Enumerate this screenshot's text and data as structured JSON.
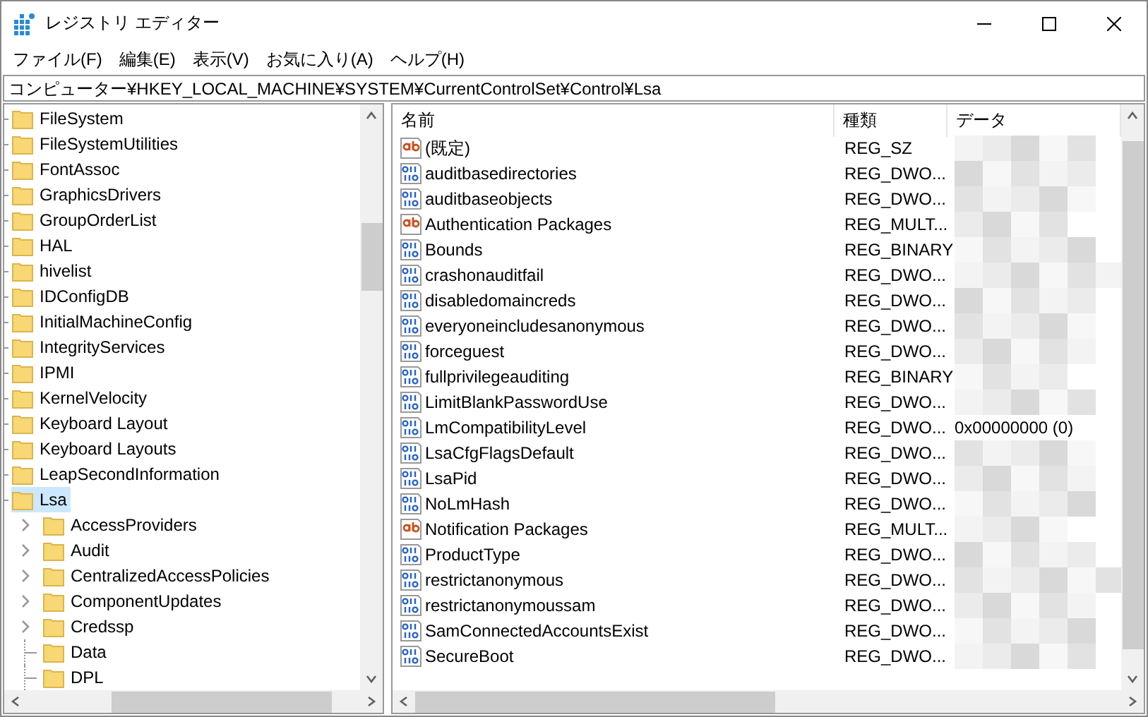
{
  "window": {
    "title": "レジストリ エディター"
  },
  "menu": [
    "ファイル(F)",
    "編集(E)",
    "表示(V)",
    "お気に入り(A)",
    "ヘルプ(H)"
  ],
  "address": "コンピューター¥HKEY_LOCAL_MACHINE¥SYSTEM¥CurrentControlSet¥Control¥Lsa",
  "tree": [
    {
      "label": "FileSystem",
      "selected": false
    },
    {
      "label": "FileSystemUtilities",
      "selected": false
    },
    {
      "label": "FontAssoc",
      "selected": false
    },
    {
      "label": "GraphicsDrivers",
      "selected": false
    },
    {
      "label": "GroupOrderList",
      "selected": false
    },
    {
      "label": "HAL",
      "selected": false
    },
    {
      "label": "hivelist",
      "selected": false
    },
    {
      "label": "IDConfigDB",
      "selected": false
    },
    {
      "label": "InitialMachineConfig",
      "selected": false
    },
    {
      "label": "IntegrityServices",
      "selected": false
    },
    {
      "label": "IPMI",
      "selected": false
    },
    {
      "label": "KernelVelocity",
      "selected": false
    },
    {
      "label": "Keyboard Layout",
      "selected": false
    },
    {
      "label": "Keyboard Layouts",
      "selected": false
    },
    {
      "label": "LeapSecondInformation",
      "selected": false
    },
    {
      "label": "Lsa",
      "selected": true,
      "children": [
        {
          "label": "AccessProviders",
          "selected": false,
          "has_children": true
        },
        {
          "label": "Audit",
          "selected": false,
          "has_children": true
        },
        {
          "label": "CentralizedAccessPolicies",
          "selected": false,
          "has_children": true
        },
        {
          "label": "ComponentUpdates",
          "selected": false,
          "has_children": true
        },
        {
          "label": "Credssp",
          "selected": false,
          "has_children": true
        },
        {
          "label": "Data",
          "selected": false,
          "has_children": false
        },
        {
          "label": "DPL",
          "selected": false,
          "has_children": false
        }
      ]
    }
  ],
  "table": {
    "columns": [
      "名前",
      "種類",
      "データ"
    ],
    "rows": [
      {
        "kind": "string",
        "name": "(既定)",
        "type": "REG_SZ",
        "redacted": true
      },
      {
        "kind": "binary",
        "name": "auditbasedirectories",
        "type": "REG_DWO...",
        "redacted": true
      },
      {
        "kind": "binary",
        "name": "auditbaseobjects",
        "type": "REG_DWO...",
        "redacted": true
      },
      {
        "kind": "string",
        "name": "Authentication Packages",
        "type": "REG_MULT...",
        "redacted": true
      },
      {
        "kind": "binary",
        "name": "Bounds",
        "type": "REG_BINARY",
        "redacted": true
      },
      {
        "kind": "binary",
        "name": "crashonauditfail",
        "type": "REG_DWO...",
        "redacted": true
      },
      {
        "kind": "binary",
        "name": "disabledomaincreds",
        "type": "REG_DWO...",
        "redacted": true
      },
      {
        "kind": "binary",
        "name": "everyoneincludesanonymous",
        "type": "REG_DWO...",
        "redacted": true
      },
      {
        "kind": "binary",
        "name": "forceguest",
        "type": "REG_DWO...",
        "redacted": true
      },
      {
        "kind": "binary",
        "name": "fullprivilegeauditing",
        "type": "REG_BINARY",
        "redacted": true
      },
      {
        "kind": "binary",
        "name": "LimitBlankPasswordUse",
        "type": "REG_DWO...",
        "redacted": true
      },
      {
        "kind": "binary",
        "name": "LmCompatibilityLevel",
        "type": "REG_DWO...",
        "redacted": false,
        "data": "0x00000000 (0)"
      },
      {
        "kind": "binary",
        "name": "LsaCfgFlagsDefault",
        "type": "REG_DWO...",
        "redacted": true
      },
      {
        "kind": "binary",
        "name": "LsaPid",
        "type": "REG_DWO...",
        "redacted": true
      },
      {
        "kind": "binary",
        "name": "NoLmHash",
        "type": "REG_DWO...",
        "redacted": true
      },
      {
        "kind": "string",
        "name": "Notification Packages",
        "type": "REG_MULT...",
        "redacted": true
      },
      {
        "kind": "binary",
        "name": "ProductType",
        "type": "REG_DWO...",
        "redacted": true
      },
      {
        "kind": "binary",
        "name": "restrictanonymous",
        "type": "REG_DWO...",
        "redacted": true
      },
      {
        "kind": "binary",
        "name": "restrictanonymoussam",
        "type": "REG_DWO...",
        "redacted": true
      },
      {
        "kind": "binary",
        "name": "SamConnectedAccountsExist",
        "type": "REG_DWO...",
        "redacted": true
      },
      {
        "kind": "binary",
        "name": "SecureBoot",
        "type": "REG_DWO...",
        "redacted": true
      }
    ]
  }
}
